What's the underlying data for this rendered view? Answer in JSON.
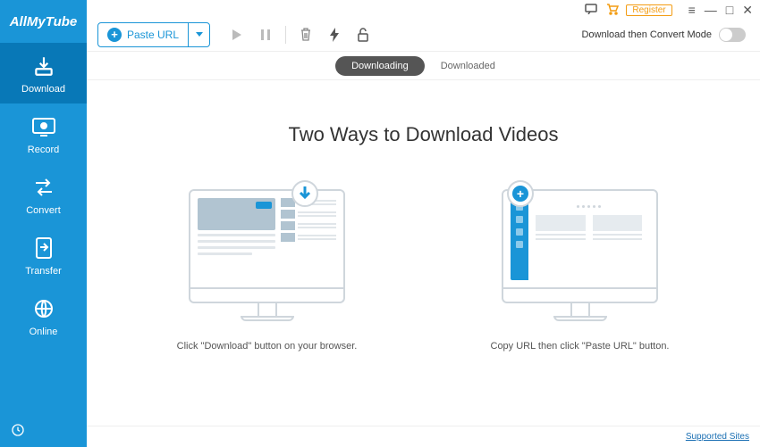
{
  "brand": "AllMyTube",
  "sidebar": {
    "items": [
      {
        "label": "Download"
      },
      {
        "label": "Record"
      },
      {
        "label": "Convert"
      },
      {
        "label": "Transfer"
      },
      {
        "label": "Online"
      }
    ]
  },
  "titlebar": {
    "register": "Register"
  },
  "toolbar": {
    "paste_url": "Paste URL",
    "convert_mode": "Download then Convert Mode"
  },
  "tabs": {
    "downloading": "Downloading",
    "downloaded": "Downloaded"
  },
  "content": {
    "headline": "Two Ways to Download Videos",
    "caption_left": "Click \"Download\" button on your browser.",
    "caption_right": "Copy URL then click \"Paste URL\" button."
  },
  "footer": {
    "supported_sites": "Supported Sites"
  }
}
